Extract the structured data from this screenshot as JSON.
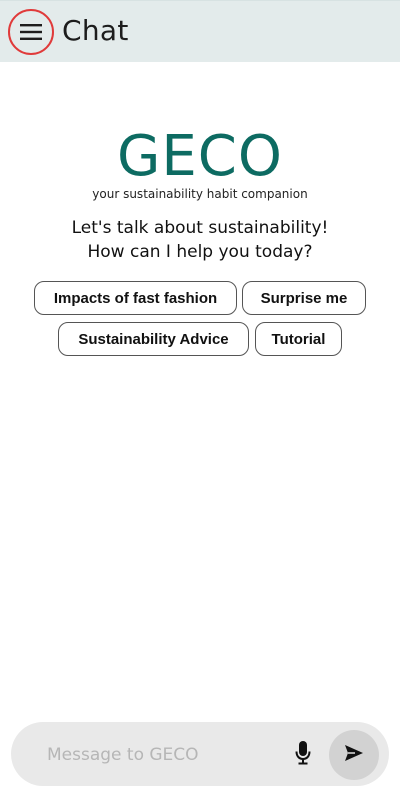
{
  "header": {
    "title": "Chat",
    "menu_icon": "hamburger-menu-icon",
    "highlight_color": "#e03a3a",
    "background": "#e3ebeb"
  },
  "hero": {
    "logo": "GECO",
    "logo_color": "#0d6b62",
    "tagline": "your sustainability habit companion",
    "greeting_line1": "Let's talk about sustainability!",
    "greeting_line2": "How can I help you today?"
  },
  "suggestions": [
    {
      "label": "Impacts of fast fashion"
    },
    {
      "label": "Surprise me"
    },
    {
      "label": "Sustainability Advice"
    },
    {
      "label": "Tutorial"
    }
  ],
  "composer": {
    "placeholder": "Message to GECO",
    "value": "",
    "mic_icon": "microphone-icon",
    "send_icon": "send-icon"
  }
}
